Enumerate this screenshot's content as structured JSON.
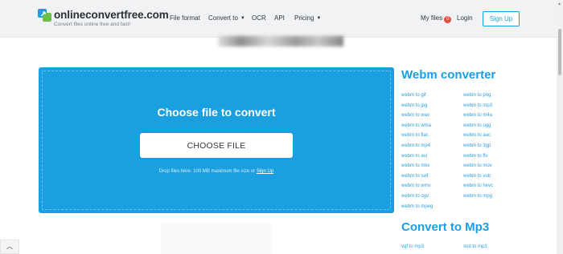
{
  "header": {
    "logo": {
      "name": "onlineconvertfree.com",
      "tagline": "Convert files online free and fast!",
      "icon": "logo-swap-icon"
    },
    "nav": [
      {
        "label": "File format",
        "dropdown": false
      },
      {
        "label": "Convert to",
        "dropdown": true
      },
      {
        "label": "OCR",
        "dropdown": false
      },
      {
        "label": "API",
        "dropdown": false
      },
      {
        "label": "Pricing",
        "dropdown": true
      }
    ],
    "my_files": {
      "label": "My files",
      "count": "0"
    },
    "login_label": "Login",
    "signup_label": "Sign Up"
  },
  "upload": {
    "title": "Choose file to convert",
    "button_label": "CHOOSE FILE",
    "drop_text": "Drop files here. 100 MB maximum file size or",
    "signup_link": "Sign Up"
  },
  "sidebar": {
    "title": "Webm converter",
    "links_left": [
      "webm to gif",
      "webm to jpg",
      "webm to wav",
      "webm to wma",
      "webm to flac",
      "webm to mp4",
      "webm to avi",
      "webm to mkv",
      "webm to swf",
      "webm to wmv",
      "webm to ogv",
      "webm to mpeg"
    ],
    "links_right": [
      "webm to png",
      "webm to mp3",
      "webm to m4a",
      "webm to ogg",
      "webm to aac",
      "webm to 3gp",
      "webm to flv",
      "webm to mov",
      "webm to vob",
      "webm to hevc",
      "webm to mpg"
    ],
    "section2_title": "Convert to Mp3",
    "section2_left": [
      "vqf to mp3"
    ],
    "section2_right": [
      "snd to mp3"
    ]
  },
  "colors": {
    "accent": "#1a9ee4",
    "card": "#1aa0e0",
    "badge": "#e74c3c"
  }
}
